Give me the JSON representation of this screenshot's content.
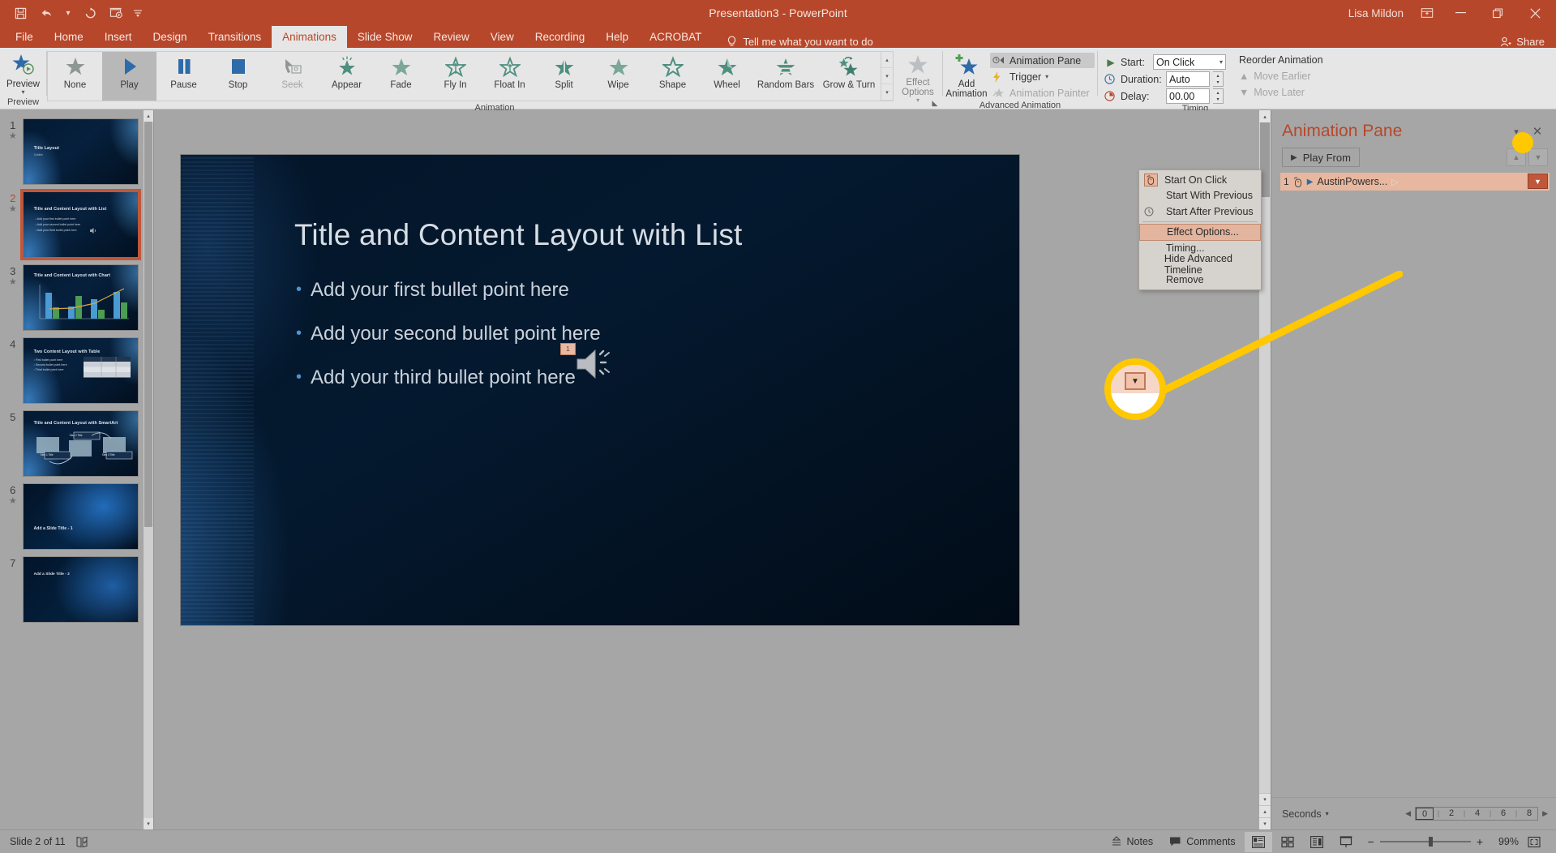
{
  "titlebar": {
    "document_title": "Presentation3  -  PowerPoint",
    "user_name": "Lisa Mildon",
    "qat": [
      {
        "name": "save",
        "glyph": "💾"
      },
      {
        "name": "undo",
        "glyph": "↶"
      },
      {
        "name": "undo-caret",
        "glyph": "▾"
      },
      {
        "name": "redo",
        "glyph": "↻"
      },
      {
        "name": "start-from-beginning",
        "glyph": "▷"
      },
      {
        "name": "customize-qat",
        "glyph": "≡"
      }
    ],
    "ribbon_display_options": "⬜",
    "minimize": "—",
    "restore": "❐",
    "close": "✕"
  },
  "tabs": [
    {
      "label": "File",
      "active": false
    },
    {
      "label": "Home",
      "active": false
    },
    {
      "label": "Insert",
      "active": false
    },
    {
      "label": "Design",
      "active": false
    },
    {
      "label": "Transitions",
      "active": false
    },
    {
      "label": "Animations",
      "active": true
    },
    {
      "label": "Slide Show",
      "active": false
    },
    {
      "label": "Review",
      "active": false
    },
    {
      "label": "View",
      "active": false
    },
    {
      "label": "Recording",
      "active": false
    },
    {
      "label": "Help",
      "active": false
    },
    {
      "label": "ACROBAT",
      "active": false
    }
  ],
  "tell_me": "Tell me what you want to do",
  "share_label": "Share",
  "ribbon": {
    "preview_group": {
      "label": "Preview",
      "button_label": "Preview"
    },
    "animation_group": {
      "label": "Animation",
      "items": [
        {
          "label": "None",
          "state": "normal",
          "icon": "star-gray"
        },
        {
          "label": "Play",
          "state": "selected",
          "icon": "play-triangle"
        },
        {
          "label": "Pause",
          "state": "normal",
          "icon": "pause-bars"
        },
        {
          "label": "Stop",
          "state": "normal",
          "icon": "stop-square"
        },
        {
          "label": "Seek",
          "state": "disabled",
          "icon": "seek-marker"
        },
        {
          "label": "Appear",
          "state": "normal",
          "icon": "star-sparkle"
        },
        {
          "label": "Fade",
          "state": "normal",
          "icon": "star-solid"
        },
        {
          "label": "Fly In",
          "state": "normal",
          "icon": "star-flyin"
        },
        {
          "label": "Float In",
          "state": "normal",
          "icon": "star-floatin"
        },
        {
          "label": "Split",
          "state": "normal",
          "icon": "star-split"
        },
        {
          "label": "Wipe",
          "state": "normal",
          "icon": "star-wipe"
        },
        {
          "label": "Shape",
          "state": "normal",
          "icon": "star-shape"
        },
        {
          "label": "Wheel",
          "state": "normal",
          "icon": "star-wheel"
        },
        {
          "label": "Random Bars",
          "state": "normal",
          "icon": "star-randombars"
        },
        {
          "label": "Grow & Turn",
          "state": "normal",
          "icon": "star-growturn"
        }
      ],
      "effect_options_label": "Effect Options",
      "effect_options_state": "disabled"
    },
    "advanced_animation_group": {
      "label": "Advanced Animation",
      "add_animation_label": "Add Animation",
      "animation_pane_label": "Animation Pane",
      "animation_pane_state": "toggled-on",
      "trigger_label": "Trigger",
      "animation_painter_label": "Animation Painter",
      "animation_painter_state": "disabled"
    },
    "timing_group": {
      "label": "Timing",
      "start_label": "Start:",
      "start_value": "On Click",
      "duration_label": "Duration:",
      "duration_value": "Auto",
      "delay_label": "Delay:",
      "delay_value": "00.00",
      "reorder_title": "Reorder Animation",
      "move_earlier_label": "Move Earlier",
      "move_later_label": "Move Later"
    }
  },
  "thumbnails": [
    {
      "number": "1",
      "title": "Title Layout",
      "subtitle": "Subtitle",
      "kind": "title",
      "selected": false
    },
    {
      "number": "2",
      "title": "Title and Content Layout with List",
      "selected": true,
      "kind": "list",
      "bullets": [
        "Add your first bullet point here",
        "Add your second bullet point here",
        "Add your third bullet point here"
      ]
    },
    {
      "number": "3",
      "title": "Title and Content Layout with Chart",
      "selected": false,
      "kind": "chart"
    },
    {
      "number": "4",
      "title": "Two Content Layout with Table",
      "selected": false,
      "kind": "table",
      "bullets": [
        "First bullet point here",
        "Second bullet point here",
        "Third bullet point here"
      ]
    },
    {
      "number": "5",
      "title": "Title and Content Layout with SmartArt",
      "selected": false,
      "kind": "smartart",
      "steps": [
        "Step 1 Title",
        "Step 2 Title",
        "Step 3 Title"
      ]
    },
    {
      "number": "6",
      "title": "Add a Slide Title - 1",
      "selected": false,
      "kind": "plain"
    },
    {
      "number": "7",
      "title": "Add a Slide Title - 2",
      "selected": false,
      "kind": "plain"
    }
  ],
  "slide": {
    "title": "Title and Content Layout with List",
    "bullets": [
      "Add your first bullet point here",
      "Add your second bullet point here",
      "Add your third bullet point here"
    ],
    "audio_badge": "1"
  },
  "animation_pane": {
    "title": "Animation Pane",
    "play_from_label": "Play From",
    "item": {
      "order": "1",
      "name": "AustinPowers...",
      "trigger_icon": "mouse-click-icon"
    },
    "timeline": {
      "seconds_label": "Seconds",
      "ticks": [
        "0",
        "2",
        "4",
        "6",
        "8"
      ]
    }
  },
  "context_menu": {
    "items": [
      {
        "label": "Start On Click",
        "underline": "C",
        "icon": "mouse-click-icon",
        "highlight": false
      },
      {
        "label": "Start With Previous",
        "underline": "W",
        "icon": "",
        "highlight": false
      },
      {
        "label": "Start After Previous",
        "underline": "A",
        "icon": "clock-icon",
        "highlight": false
      },
      {
        "label": "Effect Options...",
        "underline": "E",
        "icon": "",
        "highlight": true
      },
      {
        "label": "Timing...",
        "underline": "T",
        "icon": "",
        "highlight": false
      },
      {
        "label": "Hide Advanced Timeline",
        "underline": "H",
        "icon": "",
        "highlight": false
      },
      {
        "label": "Remove",
        "underline": "R",
        "icon": "",
        "highlight": false
      }
    ]
  },
  "statusbar": {
    "slide_indicator": "Slide 2 of 11",
    "accessibility_icon": "accessibility-checker-icon",
    "notes_label": "Notes",
    "comments_label": "Comments",
    "views": [
      {
        "name": "normal-view",
        "glyph": "▤",
        "active": true
      },
      {
        "name": "slide-sorter-view",
        "glyph": "▦",
        "active": false
      },
      {
        "name": "reading-view",
        "glyph": "▥",
        "active": false
      },
      {
        "name": "slide-show-view",
        "glyph": "⌵",
        "active": false
      }
    ],
    "zoom_out": "−",
    "zoom_in": "+",
    "zoom_level": "99%",
    "fit_to_window": "fit-slide-icon"
  },
  "colors": {
    "brand": "#b7472a",
    "ribbon_bg": "#e6e6e6",
    "pane_bg": "#a6a6a6",
    "highlight_yellow": "#ffc800",
    "accent_salmon": "#e8b79f"
  }
}
